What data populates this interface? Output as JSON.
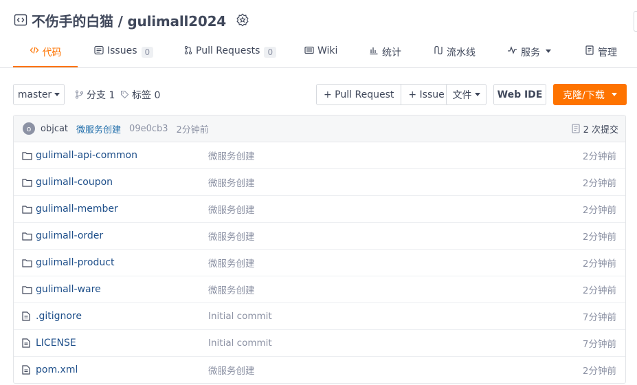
{
  "repo": {
    "title": "不伤手的白猫 / gulimall2024"
  },
  "tabs": [
    {
      "label": "代码"
    },
    {
      "label": "Issues",
      "count": "0"
    },
    {
      "label": "Pull Requests",
      "count": "0"
    },
    {
      "label": "Wiki"
    },
    {
      "label": "统计"
    },
    {
      "label": "流水线"
    },
    {
      "label": "服务"
    },
    {
      "label": "管理"
    }
  ],
  "toolbar": {
    "branch": "master",
    "branches": "分支 1",
    "tags": "标签 0",
    "pull_request": "+ Pull Request",
    "issue": "+ Issue",
    "files": "文件",
    "web_ide": "Web IDE",
    "clone": "克隆/下载"
  },
  "commit": {
    "avatar_letter": "o",
    "author": "objcat",
    "message": "微服务创建",
    "sha": "09e0cb3",
    "time": "2分钟前",
    "count_label": "2 次提交"
  },
  "files": [
    {
      "type": "folder",
      "name": "gulimall-api-common",
      "message": "微服务创建",
      "time": "2分钟前"
    },
    {
      "type": "folder",
      "name": "gulimall-coupon",
      "message": "微服务创建",
      "time": "2分钟前"
    },
    {
      "type": "folder",
      "name": "gulimall-member",
      "message": "微服务创建",
      "time": "2分钟前"
    },
    {
      "type": "folder",
      "name": "gulimall-order",
      "message": "微服务创建",
      "time": "2分钟前"
    },
    {
      "type": "folder",
      "name": "gulimall-product",
      "message": "微服务创建",
      "time": "2分钟前"
    },
    {
      "type": "folder",
      "name": "gulimall-ware",
      "message": "微服务创建",
      "time": "2分钟前"
    },
    {
      "type": "file",
      "name": ".gitignore",
      "message": "Initial commit",
      "time": "7分钟前"
    },
    {
      "type": "file",
      "name": "LICENSE",
      "message": "Initial commit",
      "time": "7分钟前"
    },
    {
      "type": "file",
      "name": "pom.xml",
      "message": "微服务创建",
      "time": "2分钟前"
    }
  ],
  "colors": {
    "accent": "#fe7300",
    "link": "#1d4e89",
    "muted": "#8c92a4",
    "text": "#40485b"
  }
}
